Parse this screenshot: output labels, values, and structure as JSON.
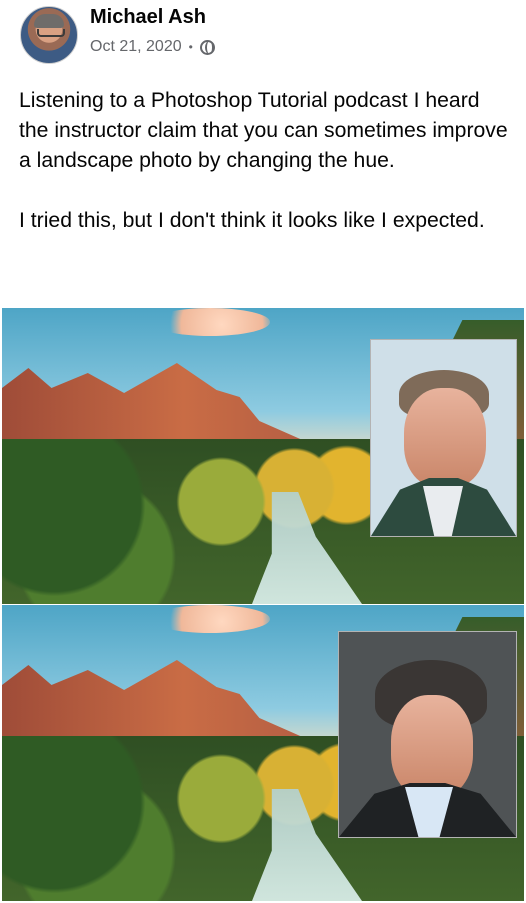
{
  "author": {
    "name": "Michael Ash"
  },
  "meta": {
    "date": "Oct 21, 2020",
    "separator": "•",
    "audience_icon": "globe-icon"
  },
  "post": {
    "paragraphs": [
      "Listening to a Photoshop Tutorial podcast I heard the instructor claim that you can sometimes improve a landscape photo by changing the hue.",
      "I tried this, but I don't think it looks like I expected."
    ]
  },
  "colors": {
    "text": "#050505",
    "secondary": "#65676b",
    "background": "#ffffff"
  }
}
